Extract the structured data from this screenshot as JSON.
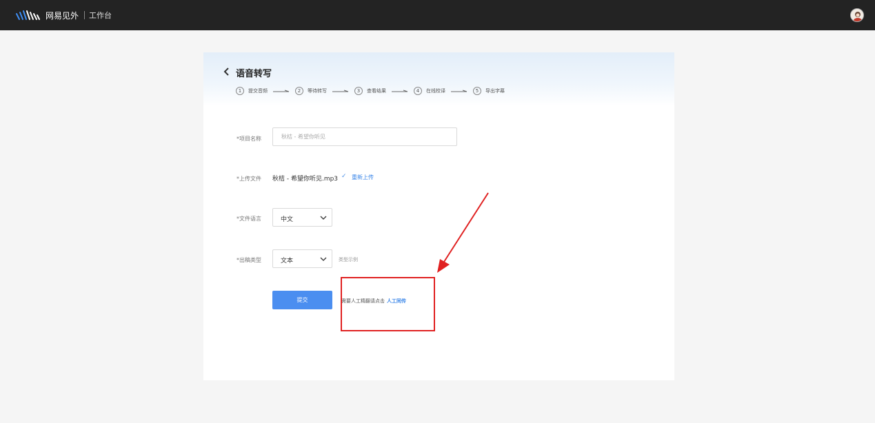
{
  "header": {
    "brand_name": "网易见外",
    "brand_sub": "工作台",
    "avatar_icon": "user-avatar"
  },
  "page": {
    "title": "语音转写",
    "back_icon": "chevron-left-icon",
    "steps": [
      {
        "num": "1",
        "label": "提交音频"
      },
      {
        "num": "2",
        "label": "等待转写"
      },
      {
        "num": "3",
        "label": "查看结果"
      },
      {
        "num": "4",
        "label": "在线校译"
      },
      {
        "num": "5",
        "label": "导出字幕"
      }
    ]
  },
  "form": {
    "project_name_label": "*项目名称",
    "project_name_value": "秋桔 - 希望你听见",
    "upload_label": "*上传文件",
    "file_name": "秋桔 - 希望你听见.mp3",
    "check_mark": "✓",
    "reupload_label": "重新上传",
    "language_label": "*文件语言",
    "language_value": "中文",
    "output_type_label": "*出稿类型",
    "output_type_value": "文本",
    "type_example_label": "类型示例",
    "submit_label": "提交",
    "hint_text": "需要人工精翻请点击",
    "hint_link": "人工同传"
  },
  "colors": {
    "topbar": "#232323",
    "accent": "#4b8ef0",
    "link": "#3a86e8",
    "annotation": "#e02020"
  }
}
